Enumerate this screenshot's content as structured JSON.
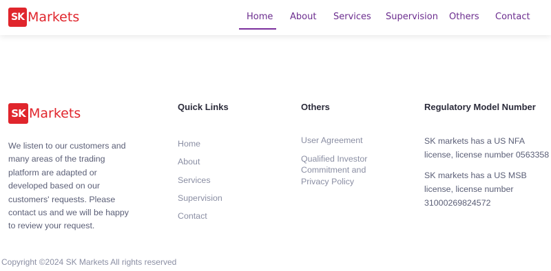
{
  "brand": {
    "logo_mark": "SK",
    "logo_text": "Markets",
    "color": "#e0252c"
  },
  "nav": {
    "items": [
      "Home",
      "About",
      "Services",
      "Supervision",
      "Others",
      "Contact"
    ],
    "active": "Home",
    "color": "#6b2c8e"
  },
  "footer": {
    "about_text": "We listen to our customers and many areas of the trading platform are adapted or developed based on our customers' requests. Please contact us and we will be happy to review your request.",
    "quick_links": {
      "title": "Quick Links",
      "items": [
        "Home",
        "About",
        "Services",
        "Supervision",
        "Contact"
      ]
    },
    "others": {
      "title": "Others",
      "items": [
        "User Agreement",
        "Qualified Investor Commitment and Privacy Policy"
      ]
    },
    "regulatory": {
      "title": "Regulatory Model Number",
      "lines": [
        "SK markets has a US NFA license, license number 0563358",
        "SK markets has a US MSB license, license number 31000269824572"
      ]
    },
    "copyright": "Copyright ©2024 SK Markets All rights reserved"
  }
}
